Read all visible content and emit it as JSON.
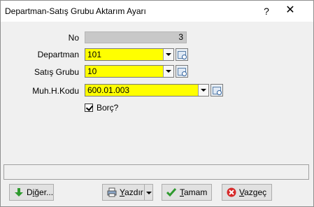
{
  "window": {
    "title": "Departman-Satış Grubu Aktarım Ayarı",
    "help_glyph": "?",
    "close_glyph": "✕"
  },
  "form": {
    "no_label": "No",
    "no_value": "3",
    "departman_label": "Departman",
    "departman_value": "101",
    "satis_grubu_label": "Satış Grubu",
    "satis_grubu_value": "10",
    "muh_kodu_label": "Muh.H.Kodu",
    "muh_kodu_value": "600.01.003",
    "borc_label": "Borç?",
    "borc_checked": true
  },
  "colors": {
    "highlight_field": "#ffff00",
    "readonly_field": "#c8c8c8"
  },
  "buttons": {
    "diger_first": "D",
    "diger_ul": "i",
    "diger_rest": "ğer...",
    "yazdir_first": "",
    "yazdir_ul": "Y",
    "yazdir_rest": "azdır",
    "tamam_first": "",
    "tamam_ul": "T",
    "tamam_rest": "amam",
    "vazgec_first": "",
    "vazgec_ul": "V",
    "vazgec_rest": "azgeç"
  },
  "icons": {
    "diger": "green-down-arrow-icon",
    "yazdir": "printer-icon",
    "tamam": "green-check-icon",
    "vazgec": "red-cancel-icon"
  }
}
